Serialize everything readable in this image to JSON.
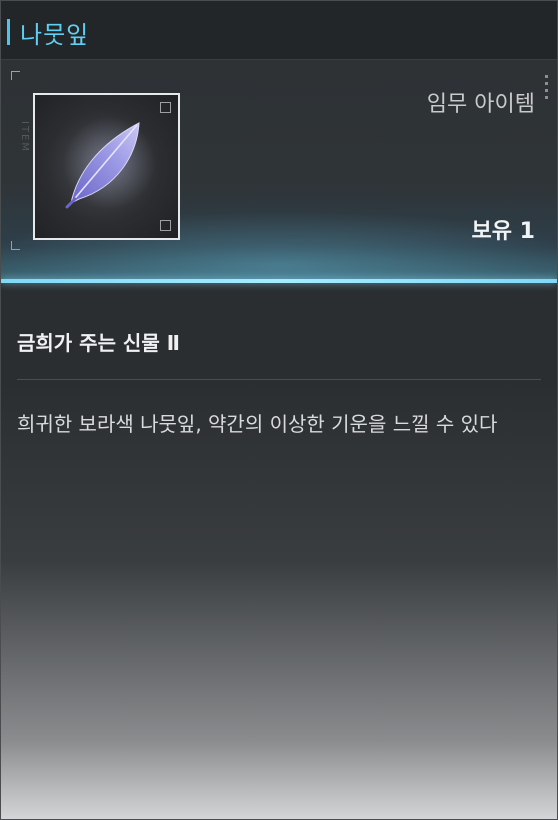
{
  "title": "나뭇잎",
  "item": {
    "type": "임무 아이템",
    "owned": "보유 1",
    "icon": "purple-leaf-icon",
    "frame_side_text": "ITEM"
  },
  "subtitle": "금희가 주는 신물 Ⅱ",
  "description": "희귀한 보라색 나뭇잎, 약간의 이상한 기운을 느낄 수 있다",
  "colors": {
    "title": "#5fd0f2",
    "accent_line": "#7fd9f5",
    "leaf": "#8a86d8"
  }
}
